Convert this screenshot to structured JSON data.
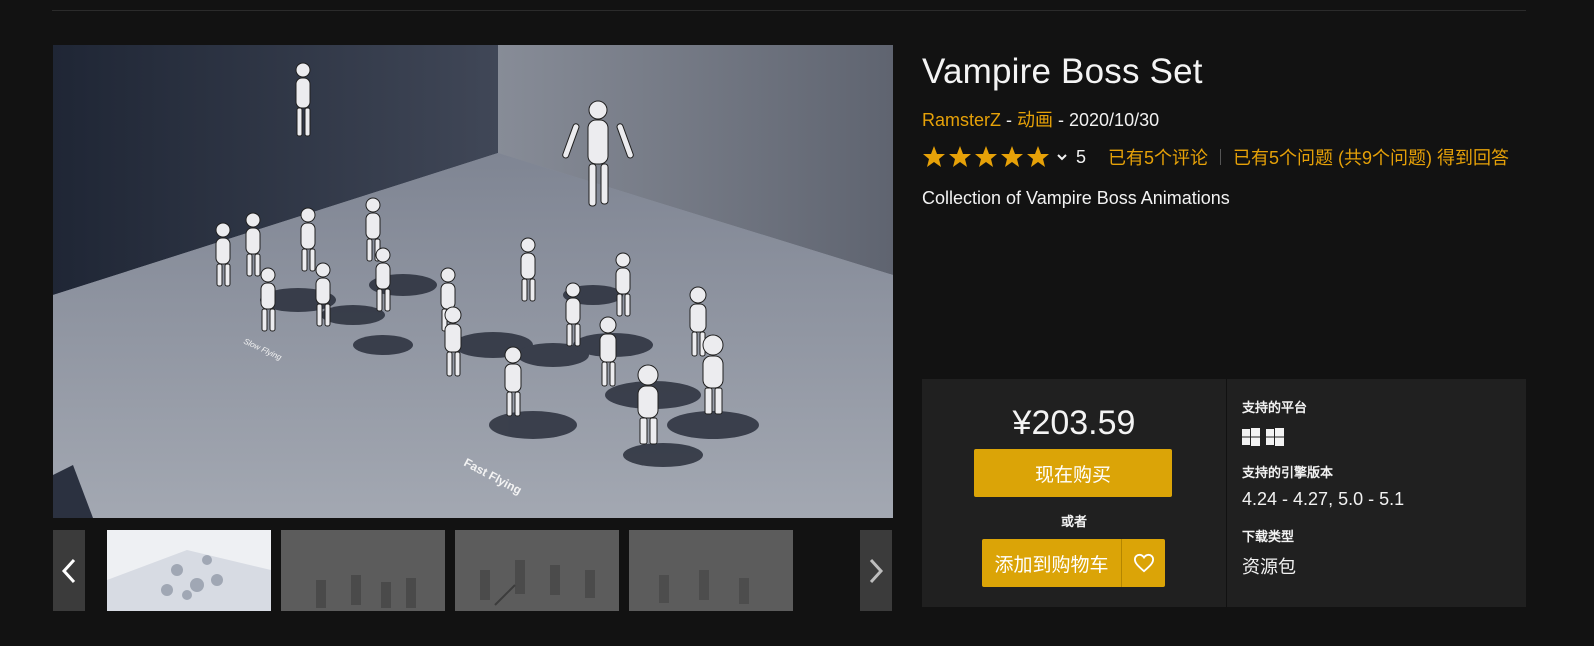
{
  "product": {
    "title": "Vampire Boss Set",
    "seller": "RamsterZ",
    "separator": " - ",
    "category": "动画",
    "release_date": "2020/10/30",
    "rating_stars": 5,
    "rating_count": "5",
    "reviews_link": "已有5个评论",
    "questions_link": "已有5个问题 (共9个问题) 得到回答",
    "summary": "Collection of Vampire Boss Animations"
  },
  "gallery": {
    "main_labels": [
      "Slow Flying",
      "Fast Flying"
    ],
    "thumbnail_count": 4,
    "active_thumbnail": 1
  },
  "purchase": {
    "price": "¥203.59",
    "buy_label": "现在购买",
    "or_label": "或者",
    "add_to_cart_label": "添加到购物车"
  },
  "specs": {
    "platforms_label": "支持的平台",
    "platform_icons": [
      "windows-icon",
      "windows-icon"
    ],
    "engine_label": "支持的引擎版本",
    "engine_value": "4.24 - 4.27, 5.0 - 5.1",
    "download_label": "下载类型",
    "download_value": "资源包"
  },
  "colors": {
    "background": "#121212",
    "accent": "#e6a108",
    "button": "#dba407",
    "panel": "#202020"
  }
}
